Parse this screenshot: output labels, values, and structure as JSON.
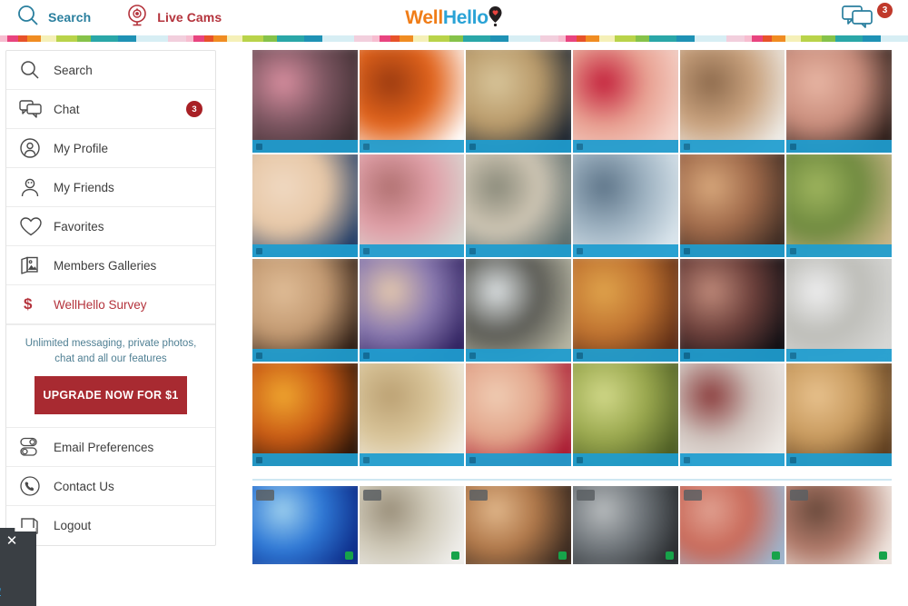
{
  "header": {
    "search_label": "Search",
    "search_icon": "search-icon",
    "livecams_label": "Live Cams",
    "livecams_icon": "webcam-icon",
    "logo_part1": "Well",
    "logo_part2": "Hello",
    "logo_pin_icon": "map-pin-heart-icon",
    "chat_icon": "chat-bubbles-icon",
    "chat_badge": "3",
    "colors": {
      "search_blue": "#2a7f9e",
      "cams_red": "#b4333c",
      "logo_orange": "#f07d18",
      "logo_blue": "#2aa3d6",
      "badge_red": "#c0392b"
    }
  },
  "sidebar": {
    "items": [
      {
        "label": "Search",
        "icon": "search-icon",
        "badge": null,
        "accent": false
      },
      {
        "label": "Chat",
        "icon": "chat-icon",
        "badge": "3",
        "accent": false
      },
      {
        "label": "My Profile",
        "icon": "profile-icon",
        "badge": null,
        "accent": false
      },
      {
        "label": "My Friends",
        "icon": "friends-icon",
        "badge": null,
        "accent": false
      },
      {
        "label": "Favorites",
        "icon": "heart-icon",
        "badge": null,
        "accent": false
      },
      {
        "label": "Members Galleries",
        "icon": "gallery-icon",
        "badge": null,
        "accent": false
      },
      {
        "label": "WellHello Survey",
        "icon": "dollar-icon",
        "badge": null,
        "accent": true
      }
    ],
    "promo": {
      "text": "Unlimited messaging, private photos, chat and all our features",
      "button_label": "UPGRADE NOW FOR $1",
      "button_color": "#a82a31"
    },
    "footer_items": [
      {
        "label": "Email Preferences",
        "icon": "toggle-switches-icon"
      },
      {
        "label": "Contact Us",
        "icon": "phone-icon"
      },
      {
        "label": "Logout",
        "icon": "logout-icon"
      }
    ]
  },
  "popup": {
    "close_icon": "close-icon",
    "text": "king",
    "link": "now"
  },
  "gallery": {
    "grid": [
      [
        {
          "c1": "#3a2b2e",
          "c2": "#7b5560",
          "c3": "#d98fa0"
        },
        {
          "c1": "#ffffff",
          "c2": "#e2641c",
          "c3": "#9a3a10"
        },
        {
          "c1": "#1b2430",
          "c2": "#b99a6a",
          "c3": "#d8c59a"
        },
        {
          "c1": "#f6d6cc",
          "c2": "#e8a091",
          "c3": "#c31f3a"
        },
        {
          "c1": "#efeeea",
          "c2": "#c9a27e",
          "c3": "#8d6a4c"
        },
        {
          "c1": "#2a1c18",
          "c2": "#c98d7c",
          "c3": "#e8b6a4"
        }
      ],
      [
        {
          "c1": "#1d3a66",
          "c2": "#e7c7a6",
          "c3": "#f0d9c2"
        },
        {
          "c1": "#d9d9d4",
          "c2": "#e0a0a8",
          "c3": "#b07070"
        },
        {
          "c1": "#5a6a6a",
          "c2": "#cfc6b4",
          "c3": "#8a8a7a"
        },
        {
          "c1": "#dce7ee",
          "c2": "#9fb3c2",
          "c3": "#5d7488"
        },
        {
          "c1": "#3b2a22",
          "c2": "#a06a4a",
          "c3": "#d8a87c"
        },
        {
          "c1": "#c8b486",
          "c2": "#6f8a3f",
          "c3": "#9fb55e"
        }
      ],
      [
        {
          "c1": "#2a1a12",
          "c2": "#c39a72",
          "c3": "#e0bd97"
        },
        {
          "c1": "#2d1f5e",
          "c2": "#8a7ab0",
          "c3": "#e5c9ad"
        },
        {
          "c1": "#b6b5a2",
          "c2": "#5a5a54",
          "c3": "#dfe4e6"
        },
        {
          "c1": "#5a2a14",
          "c2": "#c07330",
          "c3": "#e0a44c"
        },
        {
          "c1": "#0d0d12",
          "c2": "#6b3f3a",
          "c3": "#c08a7a"
        },
        {
          "c1": "#d8d8d6",
          "c2": "#bdbdb8",
          "c3": "#efeff0"
        }
      ],
      [
        {
          "c1": "#2a1408",
          "c2": "#c95a14",
          "c3": "#f0a830"
        },
        {
          "c1": "#f3efe6",
          "c2": "#d9c59a",
          "c3": "#bba072"
        },
        {
          "c1": "#a8162f",
          "c2": "#e2a48a",
          "c3": "#f0cdb4"
        },
        {
          "c1": "#4a5a22",
          "c2": "#9aa84e",
          "c3": "#d2d98a"
        },
        {
          "c1": "#efece8",
          "c2": "#cfc3bd",
          "c3": "#8a3a3a"
        },
        {
          "c1": "#5a3a1c",
          "c2": "#c89a5e",
          "c3": "#e8c28e"
        }
      ]
    ],
    "strip": [
      {
        "c1": "#0d2d8a",
        "c2": "#2f79d6",
        "c3": "#9ed0ee"
      },
      {
        "c1": "#f0efec",
        "c2": "#cfc9b8",
        "c3": "#9a8f7a"
      },
      {
        "c1": "#3a2a20",
        "c2": "#b0784a",
        "c3": "#e0b68a"
      },
      {
        "c1": "#2a2d30",
        "c2": "#6f757a",
        "c3": "#b8bcbe"
      },
      {
        "c1": "#9eb4cc",
        "c2": "#c96a5a",
        "c3": "#e0a090"
      },
      {
        "c1": "#efe6e0",
        "c2": "#b07a6a",
        "c3": "#6a4a3c"
      }
    ],
    "bar_color": "#1e9dd0",
    "status_dot_color": "#17a34a"
  }
}
